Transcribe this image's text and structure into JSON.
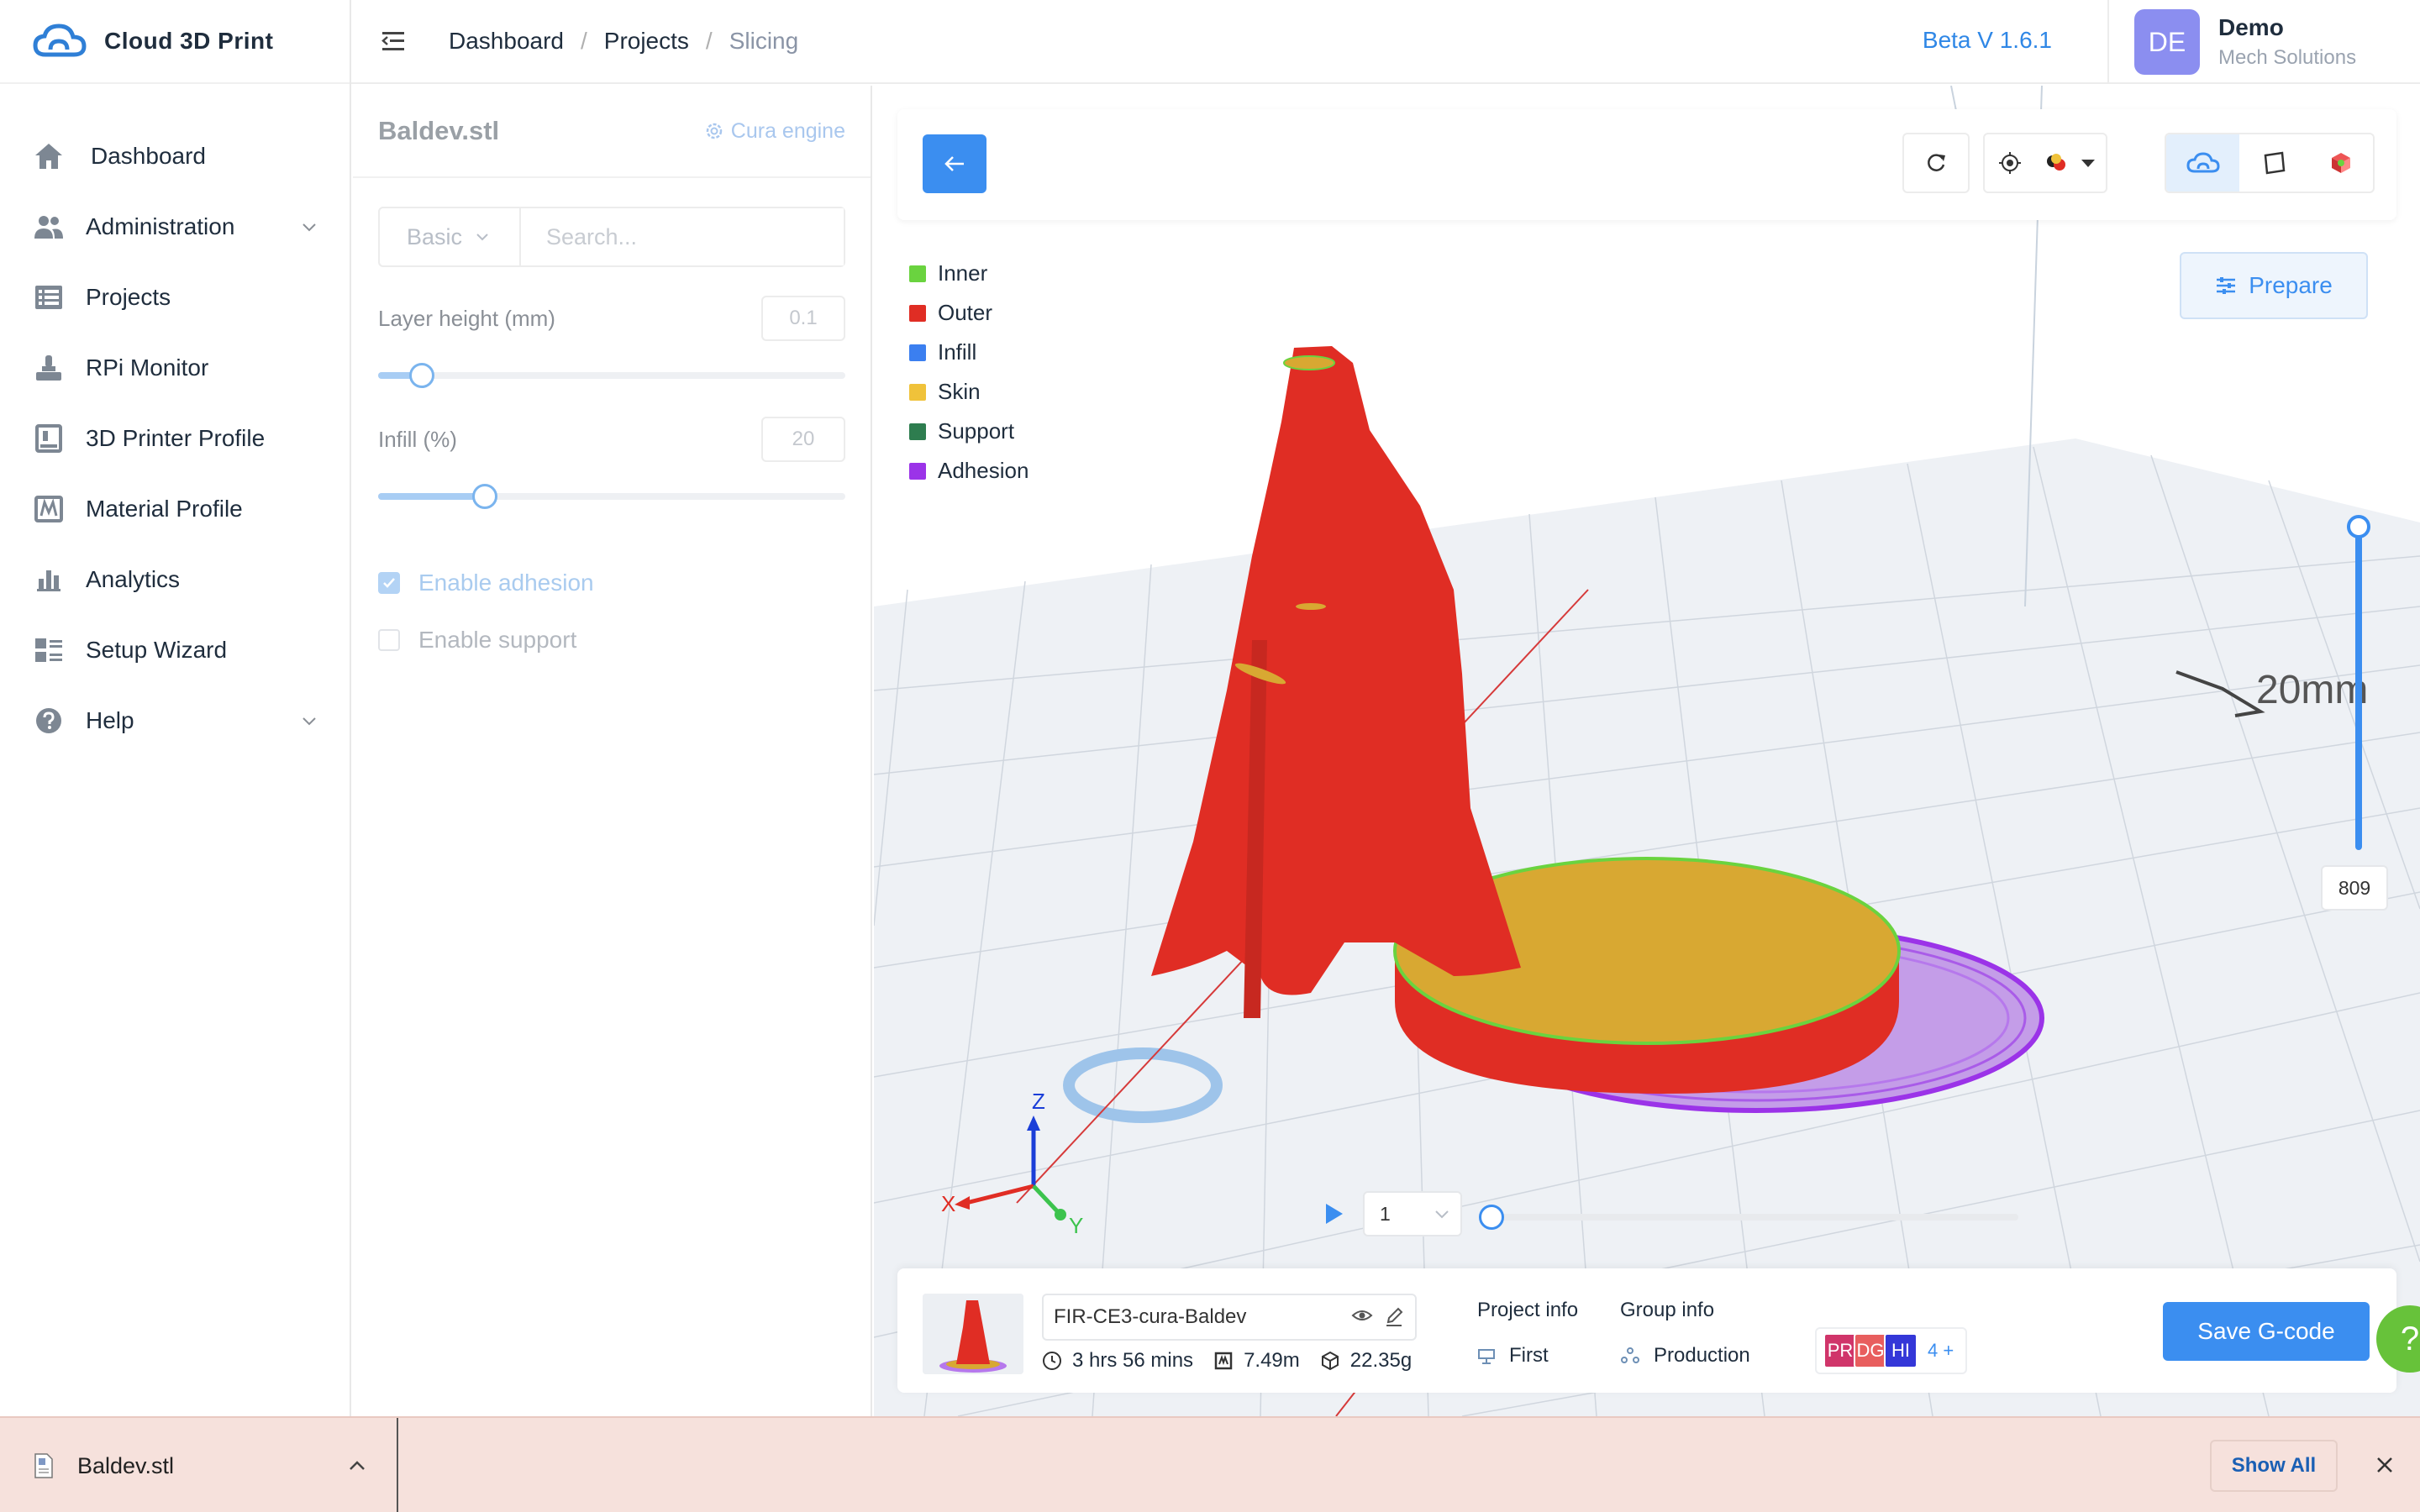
{
  "app": {
    "name": "Cloud 3D Print"
  },
  "sidebar": {
    "items": [
      {
        "label": "Dashboard",
        "icon": "home-icon"
      },
      {
        "label": "Administration",
        "icon": "users-icon",
        "expandable": true
      },
      {
        "label": "Projects",
        "icon": "list-icon"
      },
      {
        "label": "RPi Monitor",
        "icon": "monitor-icon"
      },
      {
        "label": "3D Printer Profile",
        "icon": "printer-icon"
      },
      {
        "label": "Material Profile",
        "icon": "material-icon"
      },
      {
        "label": "Analytics",
        "icon": "bar-chart-icon"
      },
      {
        "label": "Setup Wizard",
        "icon": "wizard-icon"
      },
      {
        "label": "Help",
        "icon": "help-icon",
        "expandable": true
      }
    ]
  },
  "header": {
    "breadcrumb": [
      "Dashboard",
      "Projects",
      "Slicing"
    ],
    "version": "Beta V 1.6.1",
    "user": {
      "initials": "DE",
      "name": "Demo",
      "org": "Mech Solutions"
    }
  },
  "settings": {
    "file_title": "Baldev.stl",
    "engine": "Cura engine",
    "mode": "Basic",
    "search_placeholder": "Search...",
    "layer_height": {
      "label": "Layer height (mm)",
      "value": "0.1",
      "fraction": 0.066
    },
    "infill": {
      "label": "Infill (%)",
      "value": "20",
      "fraction": 0.2
    },
    "enable_adhesion": {
      "label": "Enable adhesion",
      "checked": true
    },
    "enable_support": {
      "label": "Enable support",
      "checked": false
    }
  },
  "viewer": {
    "legend": [
      {
        "label": "Inner",
        "color": "#6ad33f"
      },
      {
        "label": "Outer",
        "color": "#e02d24"
      },
      {
        "label": "Infill",
        "color": "#3b7ff0"
      },
      {
        "label": "Skin",
        "color": "#f0c23a"
      },
      {
        "label": "Support",
        "color": "#2e7d4f"
      },
      {
        "label": "Adhesion",
        "color": "#9b33e8"
      }
    ],
    "prepare_label": "Prepare",
    "scale_label": "20mm",
    "layer_value": "809",
    "frame_value": "1",
    "axes": {
      "x": "X",
      "y": "Y",
      "z": "Z"
    }
  },
  "job": {
    "name": "FIR-CE3-cura-Baldev",
    "time": "3 hrs 56 mins",
    "length": "7.49m",
    "weight": "22.35g",
    "project_info_label": "Project info",
    "project": "First",
    "group_info_label": "Group info",
    "group": "Production",
    "members": [
      {
        "initials": "PR",
        "color": "#d0356a"
      },
      {
        "initials": "DG",
        "color": "#e85e5e"
      },
      {
        "initials": "HI",
        "color": "#3437d8"
      }
    ],
    "members_more": "4 +",
    "save_label": "Save G-code"
  },
  "downloads": {
    "file": "Baldev.stl",
    "show_all": "Show All"
  },
  "help_fab": "?"
}
